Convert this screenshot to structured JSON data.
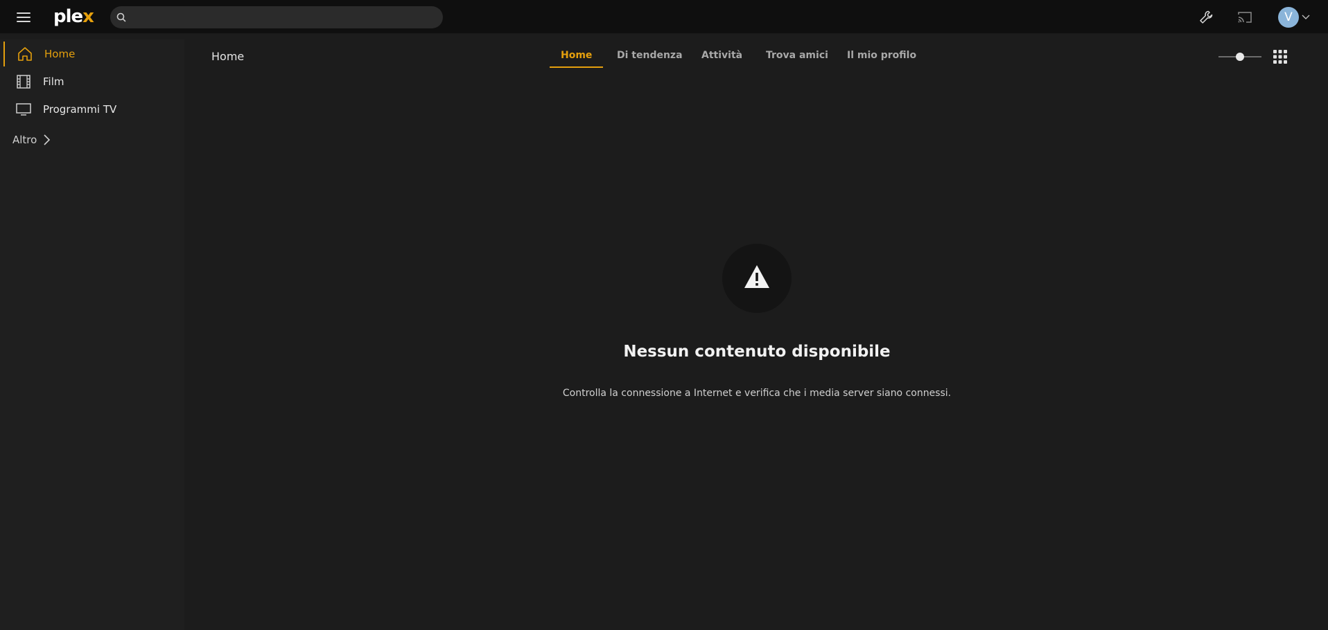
{
  "topbar": {
    "logo_prefix": "ple",
    "logo_x": "x",
    "search_placeholder": "",
    "avatar_initial": "V"
  },
  "sidebar": {
    "items": [
      {
        "label": "Home",
        "icon": "home-icon",
        "active": true
      },
      {
        "label": "Film",
        "icon": "film-icon",
        "active": false
      },
      {
        "label": "Programmi TV",
        "icon": "tv-icon",
        "active": false
      }
    ],
    "more_label": "Altro"
  },
  "header": {
    "title": "Home",
    "tabs": [
      {
        "label": "Home",
        "active": true
      },
      {
        "label": "Di tendenza",
        "active": false
      },
      {
        "label": "Attività",
        "active": false
      },
      {
        "label": "Trova amici",
        "active": false
      },
      {
        "label": "Il mio profilo",
        "active": false
      }
    ],
    "size_slider_level": 0.5
  },
  "empty_state": {
    "icon": "warning-icon",
    "title": "Nessun contenuto disponibile",
    "message": "Controlla la connessione a Internet e verifica che i media server siano connessi."
  },
  "colors": {
    "accent": "#e5a00d",
    "avatar": "#8ab4d9",
    "background": "#1c1c1c",
    "topbar": "#0f0f0f"
  }
}
